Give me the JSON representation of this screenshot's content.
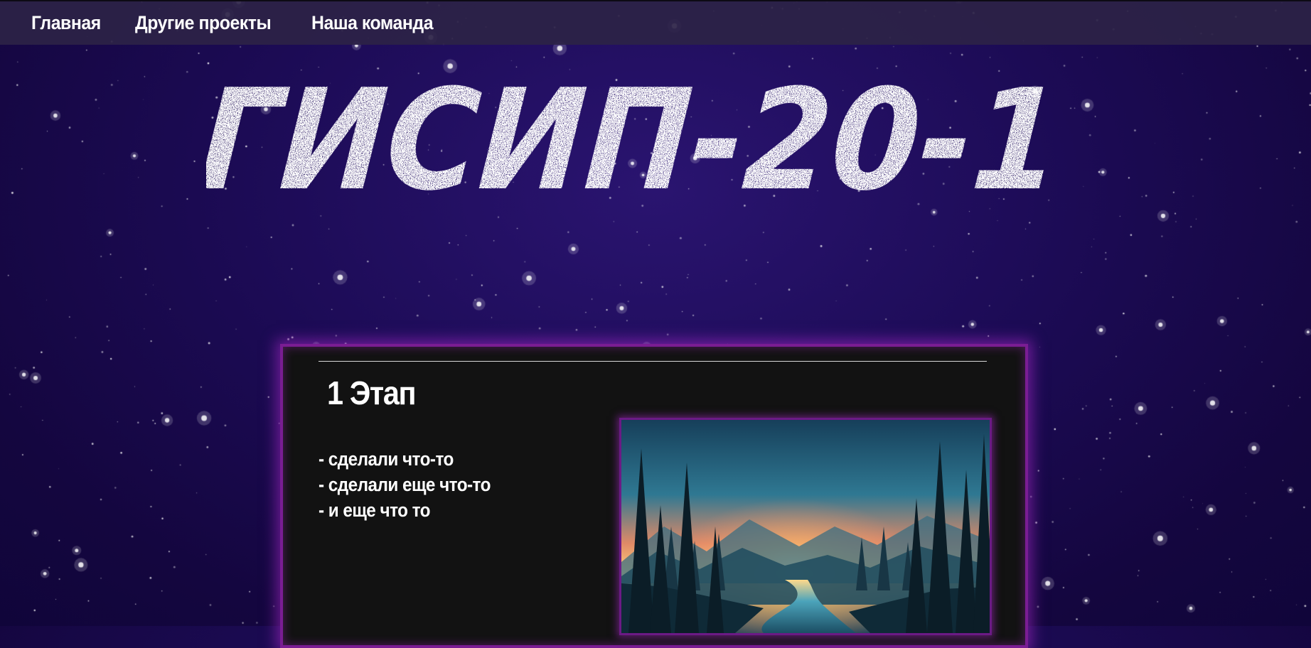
{
  "nav": {
    "items": [
      {
        "label": "Главная"
      },
      {
        "label": "Другие проекты"
      },
      {
        "label": "Наша команда"
      }
    ]
  },
  "hero": {
    "title": "ГИСИП-20-1"
  },
  "stage": {
    "title": "1 Этап",
    "items": [
      "- сделали что-то",
      "- сделали еще что-то",
      "- и еще что то"
    ],
    "image_icon": "forest-landscape-illustration"
  },
  "colors": {
    "background": "#1c0b55",
    "navbar": "#2d2346",
    "card_background": "#121212",
    "card_border": "#7a1d93",
    "text": "#ffffff"
  }
}
